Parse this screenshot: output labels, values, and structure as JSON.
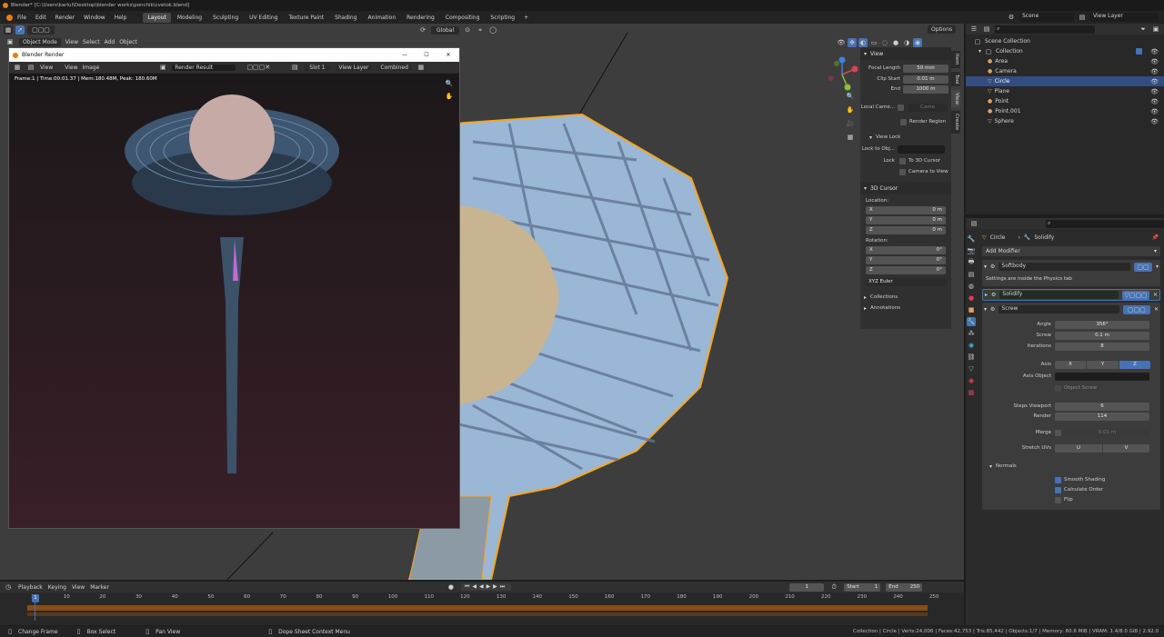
{
  "title_bar": {
    "text": "Blender* [C:\\Users\\karlul\\Desktop\\blender works\\ponchik\\cvetok.blend]"
  },
  "menu": {
    "items": [
      "File",
      "Edit",
      "Render",
      "Window",
      "Help"
    ]
  },
  "workspaces": {
    "tabs": [
      "Layout",
      "Modeling",
      "Sculpting",
      "UV Editing",
      "Texture Paint",
      "Shading",
      "Animation",
      "Rendering",
      "Compositing",
      "Scripting"
    ],
    "active": "Layout"
  },
  "scene": {
    "name": "Scene",
    "view_layer": "View Layer"
  },
  "viewport_header": {
    "mode": "Object Mode",
    "menus": [
      "View",
      "Select",
      "Add",
      "Object"
    ],
    "orientation": "Global",
    "options": "Options"
  },
  "render_window": {
    "title": "Blender Render",
    "menus": [
      "View",
      "View",
      "Image"
    ],
    "result": "Render Result",
    "slot": "Slot 1",
    "layer": "View Layer",
    "pass": "Combined",
    "info": "Frame:1 | Time:00:01.37 | Mem:180.48M, Peak: 180.60M"
  },
  "npanel": {
    "tabs": [
      "Item",
      "Tool",
      "View",
      "Create"
    ],
    "view_title": "View",
    "focal_length_label": "Focal Length",
    "focal_length": "50 mm",
    "clip_start_label": "Clip Start",
    "clip_start": "0.01 m",
    "end_label": "End",
    "end": "1000 m",
    "local_camera_label": "Local Came...",
    "local_camera": "Came",
    "render_region": "Render Region",
    "view_lock": "View Lock",
    "lock_to_obj_label": "Lock to Obj...",
    "lock_label": "Lock",
    "to_3d_cursor": "To 3D Cursor",
    "camera_to_view": "Camera to View",
    "cursor_title": "3D Cursor",
    "location_label": "Location:",
    "location": [
      {
        "axis": "X",
        "val": "0 m"
      },
      {
        "axis": "Y",
        "val": "0 m"
      },
      {
        "axis": "Z",
        "val": "0 m"
      }
    ],
    "rotation_label": "Rotation:",
    "rotation": [
      {
        "axis": "X",
        "val": "0°"
      },
      {
        "axis": "Y",
        "val": "0°"
      },
      {
        "axis": "Z",
        "val": "0°"
      }
    ],
    "rotation_mode": "XYZ Euler",
    "collections": "Collections",
    "annotations": "Annotations"
  },
  "outliner": {
    "root": "Scene Collection",
    "collection": "Collection",
    "items": [
      {
        "name": "Area",
        "selected": false
      },
      {
        "name": "Camera",
        "selected": false
      },
      {
        "name": "Circle",
        "selected": true
      },
      {
        "name": "Plane",
        "selected": false
      },
      {
        "name": "Point",
        "selected": false
      },
      {
        "name": "Point.001",
        "selected": false
      },
      {
        "name": "Sphere",
        "selected": false
      }
    ]
  },
  "properties": {
    "object": "Circle",
    "modifier_ctx": "Solidify",
    "add_modifier": "Add Modifier",
    "softbody": "Softbody",
    "softbody_note": "Settings are inside the Physics tab",
    "solidify": "Solidify",
    "screw": "Screw",
    "angle_label": "Angle",
    "angle": "356°",
    "screw_label": "Screw",
    "screw_val": "0.1 m",
    "iterations_label": "Iterations",
    "iterations": "8",
    "axis_label": "Axis",
    "axis": [
      "X",
      "Y",
      "Z"
    ],
    "axis_active": "Z",
    "axis_object_label": "Axis Object",
    "object_screw": "Object Screw",
    "steps_viewport_label": "Steps Viewport",
    "steps_viewport": "6",
    "render_label": "Render",
    "render_val": "114",
    "merge_label": "Merge",
    "merge_val": "0.01 m",
    "stretch_label": "Stretch UVs",
    "stretch_u": "U",
    "stretch_v": "V",
    "normals": "Normals",
    "smooth_shading": "Smooth Shading",
    "calculate_order": "Calculate Order",
    "flip": "Flip"
  },
  "timeline": {
    "menus": [
      "Playback",
      "Keying",
      "View",
      "Marker"
    ],
    "current_frame": "1",
    "start_label": "Start",
    "start": "1",
    "end_label": "End",
    "end": "250",
    "ticks": [
      "1",
      "10",
      "20",
      "30",
      "40",
      "50",
      "60",
      "70",
      "80",
      "90",
      "100",
      "110",
      "120",
      "130",
      "140",
      "150",
      "160",
      "170",
      "180",
      "190",
      "200",
      "210",
      "220",
      "230",
      "240",
      "250"
    ]
  },
  "status_bar": {
    "change_frame": "Change Frame",
    "box_select": "Box Select",
    "pan_view": "Pan View",
    "context_menu": "Dope Sheet Context Menu",
    "stats": "Collection | Circle | Verts:24,006 | Faces:42,753 | Tris:85,442 | Objects:1/7 | Memory: 60.6 MiB | VRAM: 1.4/8.0 GiB | 2.92.0"
  },
  "colors": {
    "accent": "#4772b3",
    "selection_outline": "#f5a623",
    "panel": "#303030",
    "header": "#232323"
  }
}
